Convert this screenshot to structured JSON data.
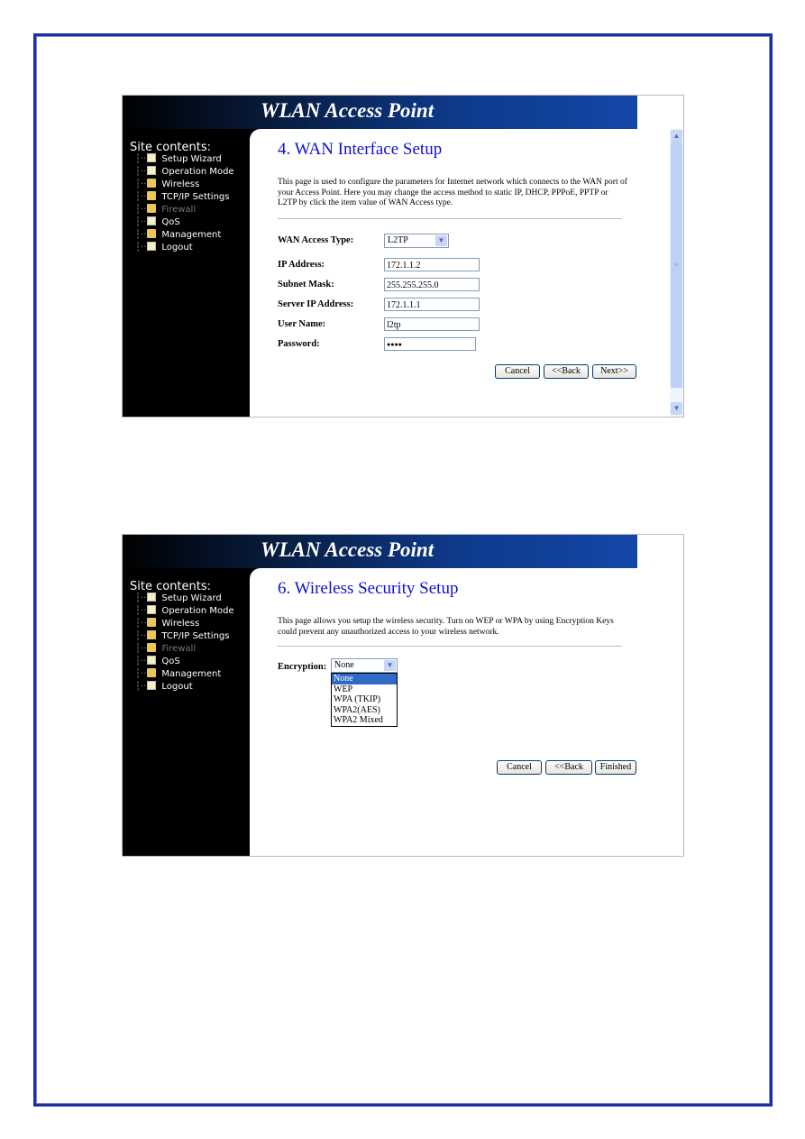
{
  "brand": "WLAN Access Point",
  "sidebar": {
    "title": "Site contents:",
    "items": [
      {
        "label": "Setup Wizard",
        "icon": "page-icon"
      },
      {
        "label": "Operation Mode",
        "icon": "page-icon"
      },
      {
        "label": "Wireless",
        "icon": "folder-icon"
      },
      {
        "label": "TCP/IP Settings",
        "icon": "folder-icon"
      },
      {
        "label": "Firewall",
        "icon": "folder-icon",
        "disabled": true
      },
      {
        "label": "QoS",
        "icon": "page-icon"
      },
      {
        "label": "Management",
        "icon": "folder-icon"
      },
      {
        "label": "Logout",
        "icon": "page-icon"
      }
    ]
  },
  "wan": {
    "title": "4. WAN Interface Setup",
    "desc": "This page is used to configure the parameters for Internet network which connects to the WAN port of your Access Point. Here you may change the access method to static IP, DHCP, PPPoE, PPTP or L2TP by click the item value of WAN Access type.",
    "access_type_label": "WAN Access Type:",
    "access_type": "L2TP",
    "ip_label": "IP Address:",
    "ip": "172.1.1.2",
    "mask_label": "Subnet Mask:",
    "mask": "255.255.255.0",
    "server_label": "Server IP Address:",
    "server": "172.1.1.1",
    "user_label": "User Name:",
    "user": "l2tp",
    "pass_label": "Password:",
    "pass": "●●●●",
    "cancel": "Cancel",
    "back": "<<Back",
    "next": "Next>>"
  },
  "sec": {
    "title": "6. Wireless Security Setup",
    "desc": "This page allows you setup the wireless security. Turn on WEP or WPA by using Encryption Keys could prevent any unauthorized access to your wireless network.",
    "enc_label": "Encryption:",
    "enc": "None",
    "options": [
      "None",
      "WEP",
      "WPA (TKIP)",
      "WPA2(AES)",
      "WPA2 Mixed"
    ],
    "cancel": "Cancel",
    "back": "<<Back",
    "finish": "Finished"
  },
  "colors": {
    "title": "#1010d0",
    "border": "#1b2fa0",
    "highlight": "#316ac5"
  }
}
